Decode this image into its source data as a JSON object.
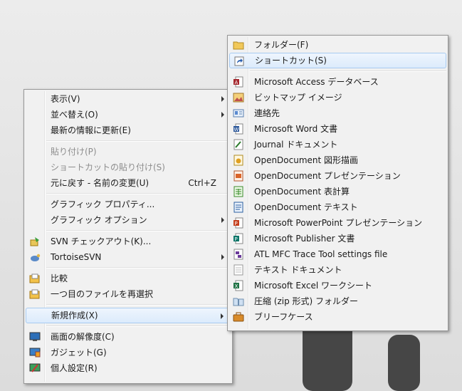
{
  "context_menu": {
    "items": [
      {
        "label": "表示(V)"
      },
      {
        "label": "並べ替え(O)"
      },
      {
        "label": "最新の情報に更新(E)"
      },
      {
        "label": "貼り付け(P)"
      },
      {
        "label": "ショートカットの貼り付け(S)"
      },
      {
        "label": "元に戻す - 名前の変更(U)",
        "shortcut": "Ctrl+Z"
      },
      {
        "label": "グラフィック プロパティ..."
      },
      {
        "label": "グラフィック オプション"
      },
      {
        "label": "SVN チェックアウト(K)...",
        "icon": "svn-checkout-icon"
      },
      {
        "label": "TortoiseSVN",
        "icon": "tortoise-icon"
      },
      {
        "label": "比較",
        "icon": "compare-icon"
      },
      {
        "label": "一つ目のファイルを再選択",
        "icon": "reselect-icon"
      },
      {
        "label": "新規作成(X)"
      },
      {
        "label": "画面の解像度(C)",
        "icon": "display-icon"
      },
      {
        "label": "ガジェット(G)",
        "icon": "gadget-icon"
      },
      {
        "label": "個人設定(R)",
        "icon": "personalize-icon"
      }
    ]
  },
  "new_submenu": {
    "items": [
      {
        "label": "フォルダー(F)",
        "icon": "folder-icon"
      },
      {
        "label": "ショートカット(S)",
        "icon": "shortcut-icon"
      },
      {
        "label": "Microsoft Access データベース",
        "icon": "access-icon"
      },
      {
        "label": "ビットマップ イメージ",
        "icon": "bitmap-icon"
      },
      {
        "label": "連絡先",
        "icon": "contact-icon"
      },
      {
        "label": "Microsoft Word 文書",
        "icon": "word-icon"
      },
      {
        "label": "Journal ドキュメント",
        "icon": "journal-icon"
      },
      {
        "label": "OpenDocument 図形描画",
        "icon": "od-draw-icon"
      },
      {
        "label": "OpenDocument プレゼンテーション",
        "icon": "od-presentation-icon"
      },
      {
        "label": "OpenDocument 表計算",
        "icon": "od-spreadsheet-icon"
      },
      {
        "label": "OpenDocument テキスト",
        "icon": "od-text-icon"
      },
      {
        "label": "Microsoft PowerPoint プレゼンテーション",
        "icon": "powerpoint-icon"
      },
      {
        "label": "Microsoft Publisher 文書",
        "icon": "publisher-icon"
      },
      {
        "label": "ATL MFC Trace Tool settings file",
        "icon": "trace-tool-icon"
      },
      {
        "label": "テキスト ドキュメント",
        "icon": "text-document-icon"
      },
      {
        "label": "Microsoft Excel ワークシート",
        "icon": "excel-icon"
      },
      {
        "label": "圧縮 (zip 形式) フォルダー",
        "icon": "zip-folder-icon"
      },
      {
        "label": "ブリーフケース",
        "icon": "briefcase-icon"
      }
    ]
  }
}
